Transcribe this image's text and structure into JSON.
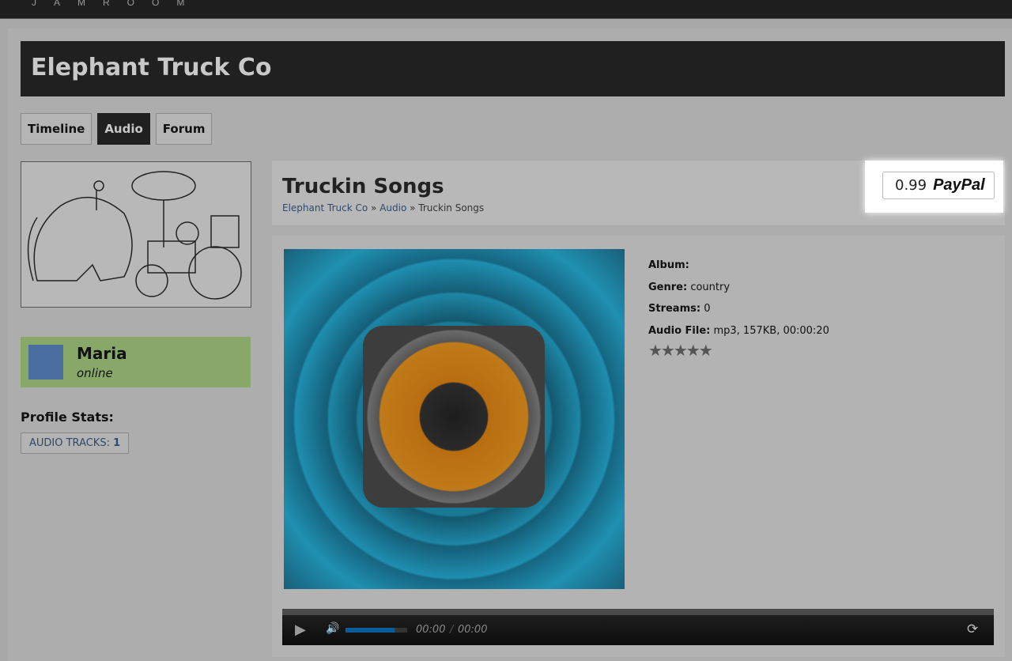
{
  "topbar": {
    "logo": "JAMROOM"
  },
  "profile": {
    "name": "Elephant Truck Co",
    "tabs": [
      "Timeline",
      "Audio",
      "Forum"
    ],
    "active_tab": "Audio"
  },
  "user": {
    "name": "Maria",
    "status": "online"
  },
  "stats": {
    "heading": "Profile Stats:",
    "audio_label": "AUDIO TRACKS:",
    "audio_count": "1"
  },
  "song": {
    "title": "Truckin Songs",
    "breadcrumb": [
      "Elephant Truck Co",
      "Audio",
      "Truckin Songs"
    ],
    "sep": "»",
    "price": "0.99",
    "paypal": "PayPal",
    "album_label": "Album:",
    "album": "",
    "genre_label": "Genre:",
    "genre": "country",
    "streams_label": "Streams:",
    "streams": "0",
    "file_label": "Audio File:",
    "file": "mp3, 157KB, 00:00:20",
    "stars": "★★★★★"
  },
  "player": {
    "current": "00:00",
    "sep": "/",
    "duration": "00:00",
    "volume": 0.8
  }
}
